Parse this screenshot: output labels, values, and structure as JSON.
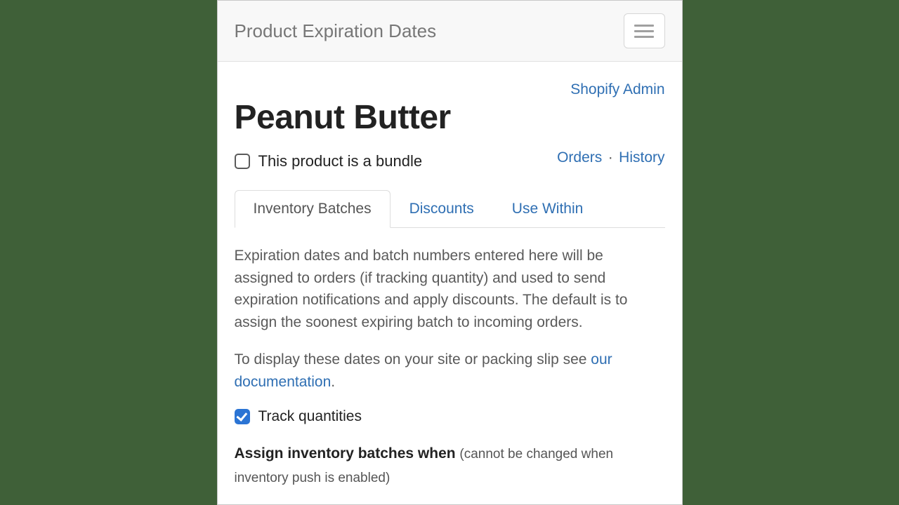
{
  "navbar": {
    "brand": "Product Expiration Dates"
  },
  "links": {
    "admin": "Shopify Admin",
    "orders": "Orders",
    "history": "History",
    "separator": "·"
  },
  "product": {
    "title": "Peanut Butter",
    "bundle_label": "This product is a bundle",
    "bundle_checked": false
  },
  "tabs": {
    "inventory": "Inventory Batches",
    "discounts": "Discounts",
    "use_within": "Use Within"
  },
  "body": {
    "desc1": "Expiration dates and batch numbers entered here will be assigned to orders (if tracking quantity) and used to send expiration notifications and apply discounts. The default is to assign the soonest expiring batch to incoming orders.",
    "desc2_pre": "To display these dates on your site or packing slip see ",
    "desc2_link": "our documentation",
    "desc2_post": ".",
    "track_label": "Track quantities",
    "track_checked": true,
    "assign_strong": "Assign inventory batches when ",
    "assign_note": "(cannot be changed when inventory push is enabled)"
  }
}
